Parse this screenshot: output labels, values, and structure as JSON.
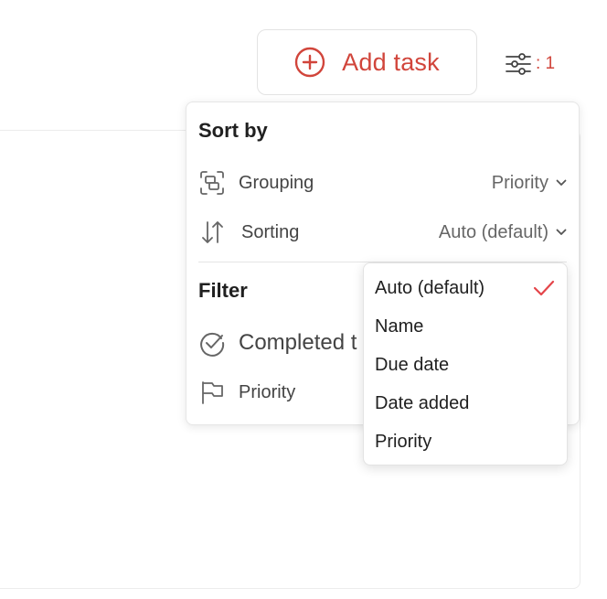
{
  "header": {
    "add_task_label": "Add task",
    "view_options_count": ": 1",
    "accent_color": "#d1453b"
  },
  "popover": {
    "sort_title": "Sort by",
    "grouping": {
      "label": "Grouping",
      "value": "Priority",
      "icon": "grouping-icon"
    },
    "sorting": {
      "label": "Sorting",
      "value": "Auto (default)",
      "icon": "sort-arrows-icon"
    },
    "filter_title": "Filter",
    "completed": {
      "label": "Completed t",
      "icon": "check-circle-icon"
    },
    "priority": {
      "label": "Priority",
      "icon": "flag-icon"
    }
  },
  "sorting_dropdown": {
    "options": [
      "Auto (default)",
      "Name",
      "Due date",
      "Date added",
      "Priority"
    ],
    "selected": "Auto (default)",
    "check_color": "#e4454a"
  }
}
